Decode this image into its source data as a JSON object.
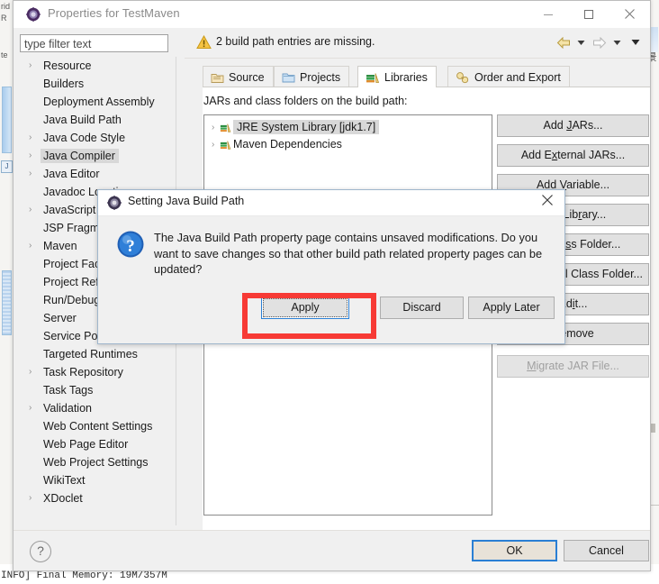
{
  "background": {
    "left_strip_lines": [
      "rid",
      "R",
      "",
      "",
      "",
      "",
      "",
      "",
      "",
      "",
      "",
      "",
      "",
      "te"
    ],
    "right_cjk": "景",
    "console_line": "INFO] Final Memory: 19M/357M"
  },
  "window": {
    "title": "Properties for TestMaven",
    "icon": "eclipse-properties-icon",
    "controls": {
      "minimize": "─",
      "maximize": "▢",
      "close": "✕"
    }
  },
  "filter": {
    "placeholder": "type filter text",
    "value": "type filter text"
  },
  "tree": {
    "items": [
      {
        "label": "Resource",
        "expandable": true,
        "selected": false
      },
      {
        "label": "Builders",
        "expandable": false,
        "selected": false
      },
      {
        "label": "Deployment Assembly",
        "expandable": false,
        "selected": false
      },
      {
        "label": "Java Build Path",
        "expandable": false,
        "selected": false
      },
      {
        "label": "Java Code Style",
        "expandable": true,
        "selected": false
      },
      {
        "label": "Java Compiler",
        "expandable": true,
        "selected": true
      },
      {
        "label": "Java Editor",
        "expandable": true,
        "selected": false
      },
      {
        "label": "Javadoc Location",
        "expandable": false,
        "selected": false
      },
      {
        "label": "JavaScript",
        "expandable": true,
        "selected": false
      },
      {
        "label": "JSP Fragment",
        "expandable": false,
        "selected": false
      },
      {
        "label": "Maven",
        "expandable": true,
        "selected": false
      },
      {
        "label": "Project Facets",
        "expandable": false,
        "selected": false
      },
      {
        "label": "Project References",
        "expandable": false,
        "selected": false
      },
      {
        "label": "Run/Debug Settings",
        "expandable": false,
        "selected": false
      },
      {
        "label": "Server",
        "expandable": false,
        "selected": false
      },
      {
        "label": "Service Policies",
        "expandable": false,
        "selected": false
      },
      {
        "label": "Targeted Runtimes",
        "expandable": false,
        "selected": false
      },
      {
        "label": "Task Repository",
        "expandable": true,
        "selected": false
      },
      {
        "label": "Task Tags",
        "expandable": false,
        "selected": false
      },
      {
        "label": "Validation",
        "expandable": true,
        "selected": false
      },
      {
        "label": "Web Content Settings",
        "expandable": false,
        "selected": false
      },
      {
        "label": "Web Page Editor",
        "expandable": false,
        "selected": false
      },
      {
        "label": "Web Project Settings",
        "expandable": false,
        "selected": false
      },
      {
        "label": "WikiText",
        "expandable": false,
        "selected": false
      },
      {
        "label": "XDoclet",
        "expandable": true,
        "selected": false
      }
    ],
    "arrow_glyph": "›"
  },
  "message": {
    "text": "2 build path entries are missing.",
    "icon": "warning-icon"
  },
  "nav": {
    "back": "back-arrow-icon",
    "back_menu": "▼",
    "forward": "forward-arrow-icon",
    "forward_menu": "▼",
    "view_menu": "▼"
  },
  "tabs": [
    {
      "label": "Source",
      "icon": "source-folder-icon",
      "active": false
    },
    {
      "label": "Projects",
      "icon": "projects-folder-icon",
      "active": false
    },
    {
      "label": "Libraries",
      "icon": "libraries-books-icon",
      "active": true
    },
    {
      "label": "Order and Export",
      "icon": "order-export-icon",
      "active": false
    }
  ],
  "panel": {
    "label": "JARs and class folders on the build path:",
    "entries": [
      {
        "label": "JRE System Library [jdk1.7]",
        "selected": true
      },
      {
        "label": "Maven Dependencies",
        "selected": false
      }
    ],
    "buttons": [
      {
        "label": "Add JARs...",
        "mnemonic": "J",
        "disabled": false
      },
      {
        "label": "Add External JARs...",
        "mnemonic": "x",
        "disabled": false
      },
      {
        "label": "Add Variable...",
        "mnemonic": "V",
        "disabled": false
      },
      {
        "label": "Add Library...",
        "mnemonic": "r",
        "disabled": false
      },
      {
        "label": "Add Class Folder...",
        "mnemonic": "s",
        "disabled": false
      },
      {
        "label": "Add External Class Folder...",
        "mnemonic": "d",
        "disabled": false
      },
      {
        "label": "Edit...",
        "mnemonic": "i",
        "disabled": false
      },
      {
        "label": "Remove",
        "mnemonic": "",
        "disabled": false
      },
      {
        "label": "Migrate JAR File...",
        "mnemonic": "M",
        "disabled": true
      }
    ]
  },
  "footer": {
    "help": "?",
    "ok": "OK",
    "cancel": "Cancel"
  },
  "modal": {
    "title": "Setting Java Build Path",
    "icon": "eclipse-properties-icon",
    "close": "✕",
    "question_icon": "question-icon",
    "message": "The Java Build Path property page contains unsaved modifications. Do you want to save changes so that other build path related property pages can be updated?",
    "buttons": [
      {
        "label": "Apply",
        "focused": true
      },
      {
        "label": "Discard",
        "focused": false
      },
      {
        "label": "Apply Later",
        "focused": false
      }
    ]
  },
  "annotation": {
    "highlight_color": "#f73a35",
    "target": "Apply"
  }
}
